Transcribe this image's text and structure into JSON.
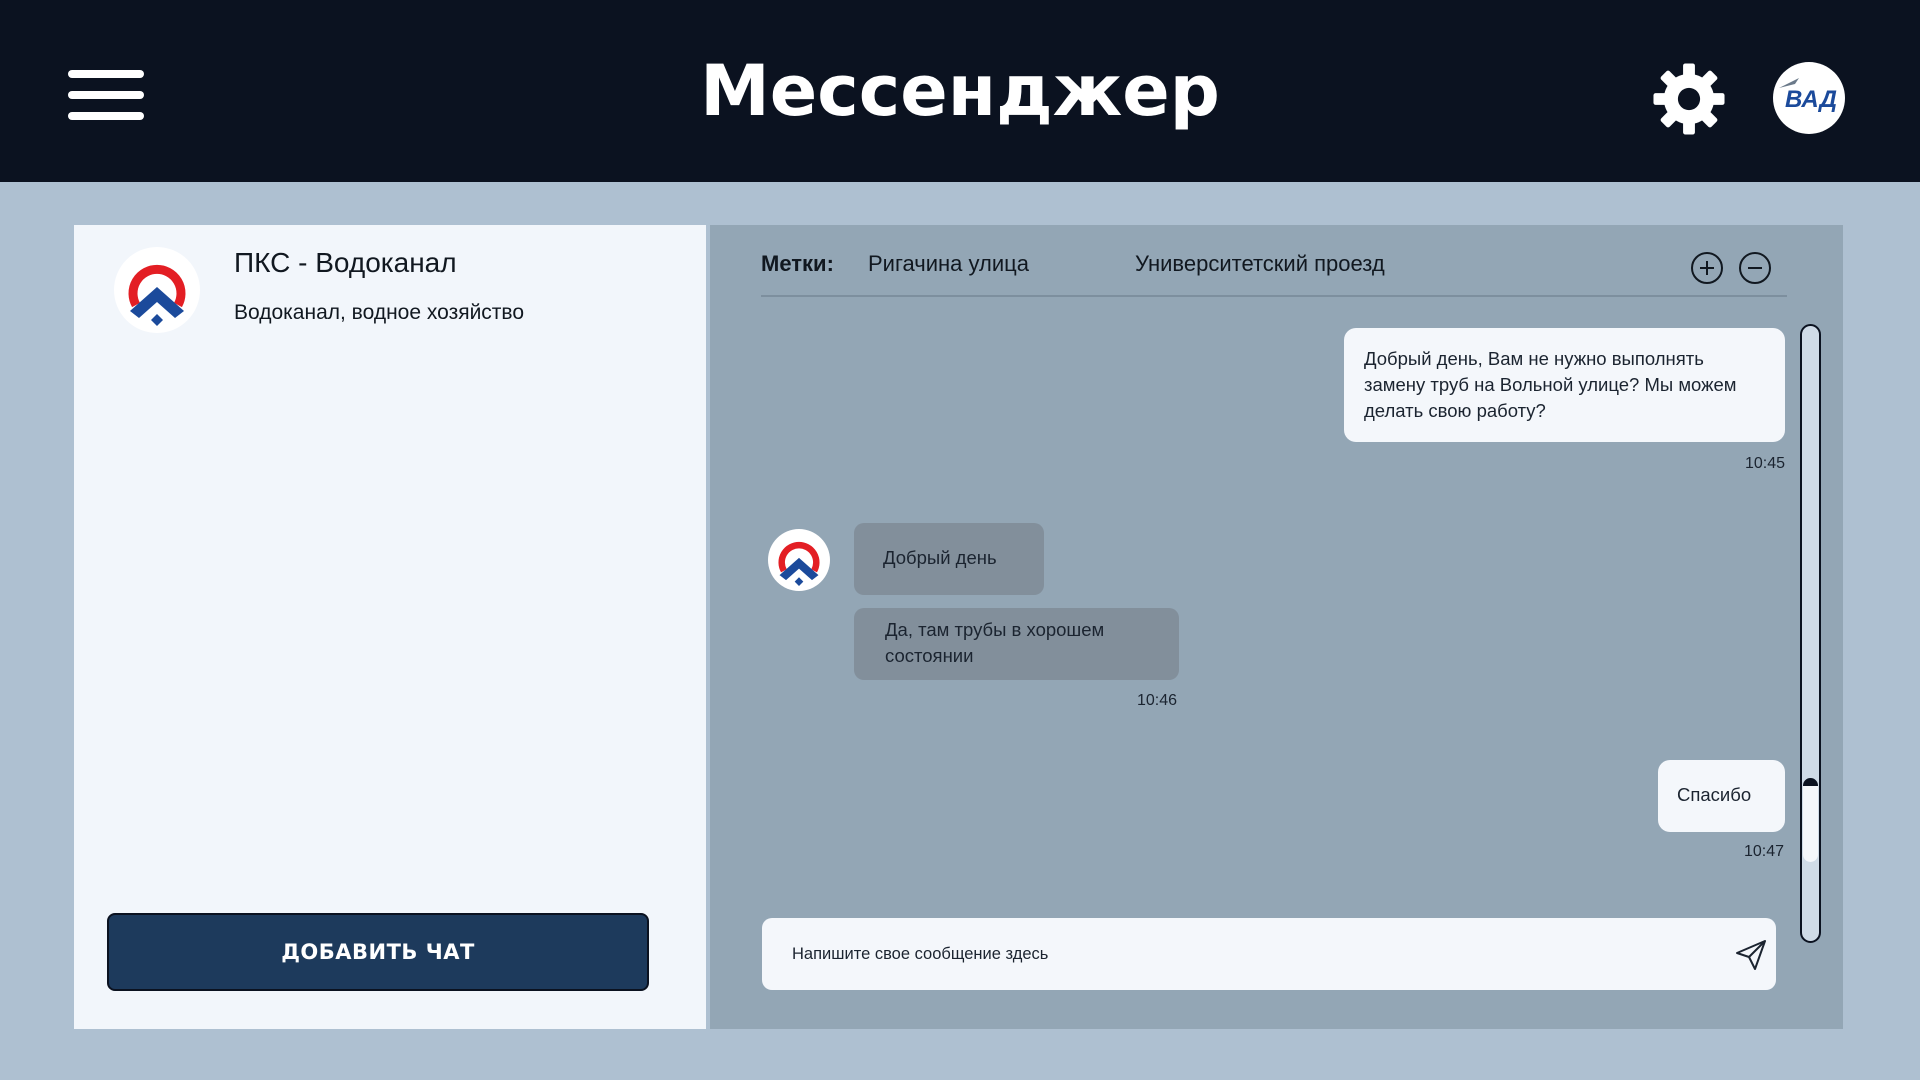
{
  "header": {
    "title": "Мессенджер",
    "menu_icon": "hamburger-menu-icon",
    "settings_icon": "gear-icon",
    "user_logo_text": "ВАД"
  },
  "colors": {
    "header_bg": "#0b1220",
    "page_bg": "#aec0d1",
    "left_panel_bg": "#f2f6fb",
    "chat_area_bg": "#93a6b5",
    "button_bg": "#1d3a5c",
    "incoming_bubble": "#828f9b",
    "outgoing_bubble": "#f4f7fb",
    "logo_red": "#e31e24",
    "logo_blue": "#1b4a9b"
  },
  "chat_list": [
    {
      "title": "ПКС - Водоканал",
      "subtitle": "Водоканал, водное хозяйство"
    }
  ],
  "add_chat_label": "ДОБАВИТЬ ЧАТ",
  "tags": {
    "label": "Метки:",
    "items": [
      "Ригачина улица",
      "Университетский проезд"
    ],
    "add_icon": "plus-circle-icon",
    "remove_icon": "minus-circle-icon"
  },
  "messages": [
    {
      "direction": "outgoing",
      "text": "Добрый день, Вам не нужно выполнять замену труб на Вольной улице? Мы можем делать свою работу?",
      "time": "10:45"
    },
    {
      "direction": "incoming",
      "text": "Добрый день"
    },
    {
      "direction": "incoming",
      "text": "Да, там трубы в хорошем состоянии",
      "time": "10:46"
    },
    {
      "direction": "outgoing",
      "text": "Спасибо",
      "time": "10:47"
    }
  ],
  "composer": {
    "placeholder": "Напишите свое сообщение здесь",
    "send_icon": "send-icon"
  }
}
